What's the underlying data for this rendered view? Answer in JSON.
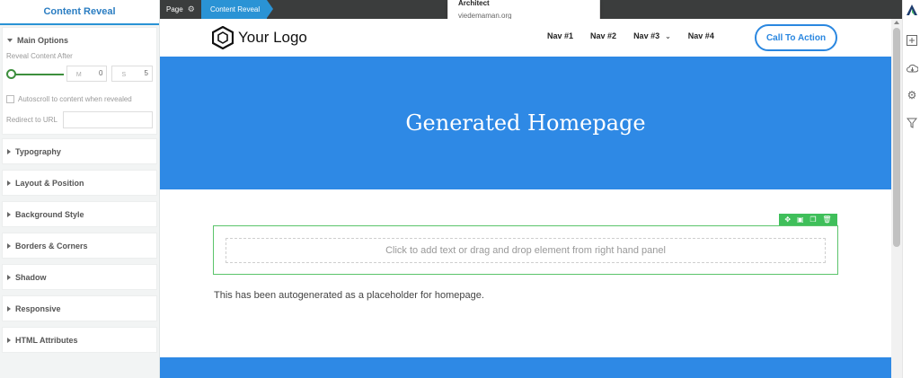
{
  "left_panel": {
    "title": "Content Reveal",
    "main_options": {
      "label": "Main Options",
      "reveal_after_label": "Reveal Content After",
      "minutes_unit": "M",
      "minutes_value": "0",
      "seconds_unit": "S",
      "seconds_value": "5",
      "autoscroll_label": "Autoscroll to content when revealed",
      "redirect_label": "Redirect to URL",
      "redirect_value": ""
    },
    "sections": [
      {
        "label": "Typography"
      },
      {
        "label": "Layout & Position"
      },
      {
        "label": "Background Style"
      },
      {
        "label": "Borders & Corners"
      },
      {
        "label": "Shadow"
      },
      {
        "label": "Responsive"
      },
      {
        "label": "HTML Attributes"
      }
    ]
  },
  "breadcrumb": {
    "page": "Page",
    "active": "Content Reveal"
  },
  "tooltip": {
    "title": "Architect",
    "domain": "viedemaman.org"
  },
  "site": {
    "logo_text": "Your Logo",
    "nav": [
      "Nav #1",
      "Nav #2",
      "Nav #3",
      "Nav #4"
    ],
    "cta": "Call To Action",
    "hero_title": "Generated Homepage",
    "drop_hint": "Click to add text or drag and drop element from right hand panel",
    "placeholder_text": "This has been autogenerated as a placeholder for homepage."
  },
  "colors": {
    "accent_blue": "#2e89e5",
    "editor_blue": "#2a93d5",
    "selection_green": "#5bc46b",
    "slider_green": "#3d8f3d"
  },
  "icons": {
    "toolbar": [
      "move-icon",
      "duplicate-icon",
      "copy-icon",
      "delete-icon"
    ],
    "right_rail": [
      "architect-logo-icon",
      "add-element-icon",
      "cloud-download-icon",
      "settings-gear-icon",
      "funnel-icon"
    ]
  }
}
